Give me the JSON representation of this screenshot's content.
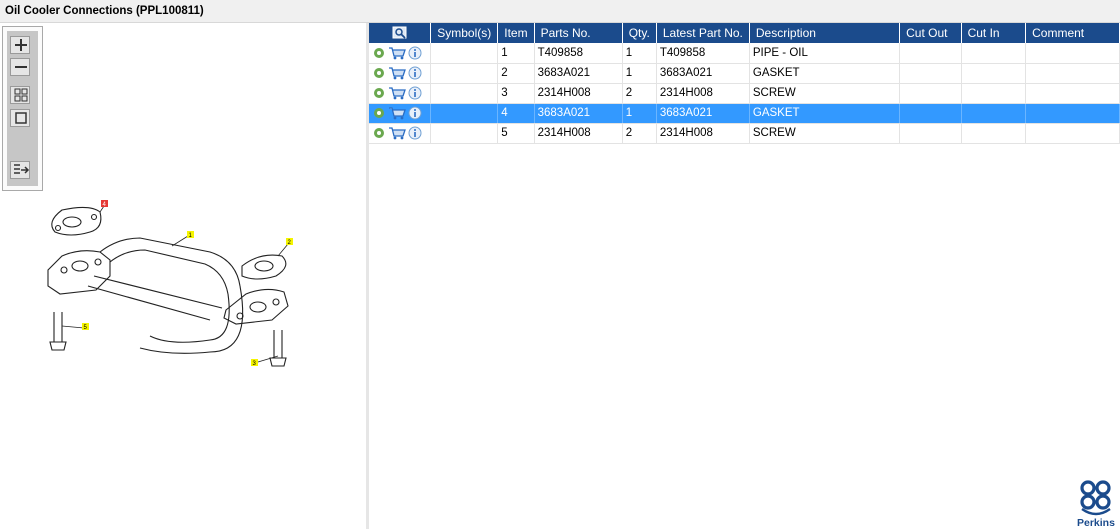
{
  "window": {
    "title": "Oil Cooler Connections (PPL100811)"
  },
  "toolbox": {
    "icons": [
      "zoom-in-icon",
      "zoom-out-icon",
      "fit-grid-icon",
      "fit-page-icon",
      "export-list-icon"
    ]
  },
  "diagram": {
    "callouts": [
      "4",
      "1",
      "2",
      "5",
      "3"
    ]
  },
  "table": {
    "columns": [
      "",
      "Symbol(s)",
      "Item",
      "Parts No.",
      "Qty.",
      "Latest Part No.",
      "Description",
      "Cut Out",
      "Cut In",
      "Comment"
    ],
    "rows": [
      {
        "symbol": "",
        "item": "1",
        "part_no": "T409858",
        "qty": "1",
        "latest_part_no": "T409858",
        "description": "PIPE - OIL",
        "cut_out": "",
        "cut_in": "",
        "comment": ""
      },
      {
        "symbol": "",
        "item": "2",
        "part_no": "3683A021",
        "qty": "1",
        "latest_part_no": "3683A021",
        "description": "GASKET",
        "cut_out": "",
        "cut_in": "",
        "comment": ""
      },
      {
        "symbol": "",
        "item": "3",
        "part_no": "2314H008",
        "qty": "2",
        "latest_part_no": "2314H008",
        "description": "SCREW",
        "cut_out": "",
        "cut_in": "",
        "comment": ""
      },
      {
        "symbol": "",
        "item": "4",
        "part_no": "3683A021",
        "qty": "1",
        "latest_part_no": "3683A021",
        "description": "GASKET",
        "cut_out": "",
        "cut_in": "",
        "comment": ""
      },
      {
        "symbol": "",
        "item": "5",
        "part_no": "2314H008",
        "qty": "2",
        "latest_part_no": "2314H008",
        "description": "SCREW",
        "cut_out": "",
        "cut_in": "",
        "comment": ""
      }
    ],
    "selected_row": 4
  },
  "brand": {
    "name": "Perkins",
    "color": "#1b4b8c"
  },
  "colors": {
    "header": "#1b4b8c",
    "selection": "#3399ff",
    "gear": "#6aa84f",
    "cart": "#2a6cc4",
    "info": "#6f9fd3"
  }
}
